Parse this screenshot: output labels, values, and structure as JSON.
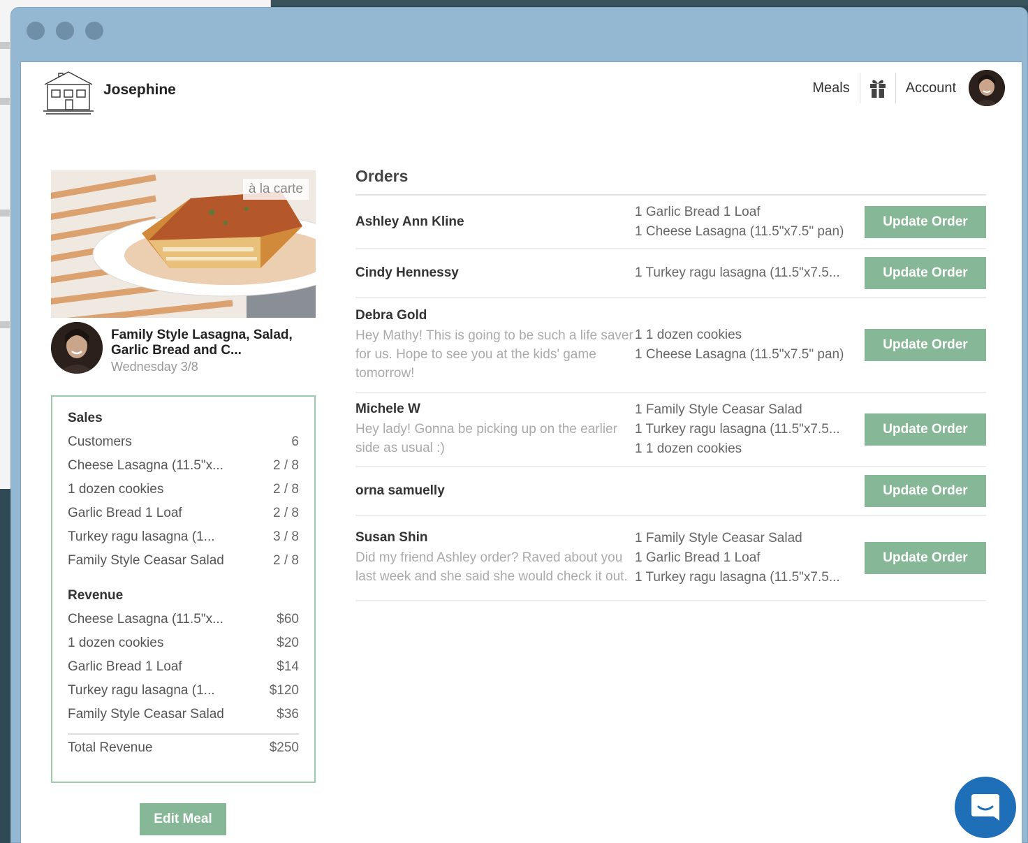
{
  "header": {
    "brand": "Josephine",
    "nav": {
      "meals": "Meals",
      "account": "Account"
    }
  },
  "meal": {
    "badge": "à la carte",
    "title": "Family Style Lasagna, Salad, Garlic Bread and C...",
    "date": "Wednesday 3/8"
  },
  "sales": {
    "heading": "Sales",
    "rows": [
      {
        "label": "Customers",
        "value": "6"
      },
      {
        "label": "Cheese Lasagna (11.5\"x...",
        "value": "2 / 8"
      },
      {
        "label": "1 dozen cookies",
        "value": "2 / 8"
      },
      {
        "label": "Garlic Bread 1 Loaf",
        "value": "2 / 8"
      },
      {
        "label": "Turkey ragu lasagna (1...",
        "value": "3 / 8"
      },
      {
        "label": "Family Style Ceasar Salad",
        "value": "2 / 8"
      }
    ]
  },
  "revenue": {
    "heading": "Revenue",
    "rows": [
      {
        "label": "Cheese Lasagna (11.5\"x...",
        "value": "$60"
      },
      {
        "label": "1 dozen cookies",
        "value": "$20"
      },
      {
        "label": "Garlic Bread 1 Loaf",
        "value": "$14"
      },
      {
        "label": "Turkey ragu lasagna (1...",
        "value": "$120"
      },
      {
        "label": "Family Style Ceasar Salad",
        "value": "$36"
      }
    ],
    "total_label": "Total Revenue",
    "total_value": "$250"
  },
  "edit_button": "Edit Meal",
  "orders": {
    "title": "Orders",
    "button_label": "Update Order",
    "list": [
      {
        "name": "Ashley Ann Kline",
        "note": "",
        "items": [
          "1 Garlic Bread 1 Loaf",
          "1 Cheese Lasagna (11.5\"x7.5\" pan)"
        ]
      },
      {
        "name": "Cindy Hennessy",
        "note": "",
        "items": [
          "1 Turkey ragu lasagna (11.5\"x7.5..."
        ]
      },
      {
        "name": "Debra Gold",
        "note": "Hey Mathy! This is going to be such a life saver for us. Hope to see you at the kids' game tomorrow!",
        "items": [
          "1 1 dozen cookies",
          "1 Cheese Lasagna (11.5\"x7.5\" pan)"
        ]
      },
      {
        "name": "Michele W",
        "note": "Hey lady! Gonna be picking up on the earlier side as usual :)",
        "items": [
          "1 Family Style Ceasar Salad",
          "1 Turkey ragu lasagna (11.5\"x7.5...",
          "1 1 dozen cookies"
        ]
      },
      {
        "name": "orna samuelly",
        "note": "",
        "items": []
      },
      {
        "name": "Susan Shin",
        "note": "Did my friend Ashley order? Raved about you last week and she said she would check it out.",
        "items": [
          "1 Family Style Ceasar Salad",
          "1 Garlic Bread 1 Loaf",
          "1 Turkey ragu lasagna (11.5\"x7.5..."
        ]
      }
    ]
  },
  "icons": {
    "logo": "house-logo-icon",
    "gift": "gift-icon",
    "chat": "chat-bubble-icon"
  },
  "colors": {
    "accent_green": "#86b796",
    "chat_blue": "#1f6fb8",
    "window_frame": "#94b7d2"
  }
}
